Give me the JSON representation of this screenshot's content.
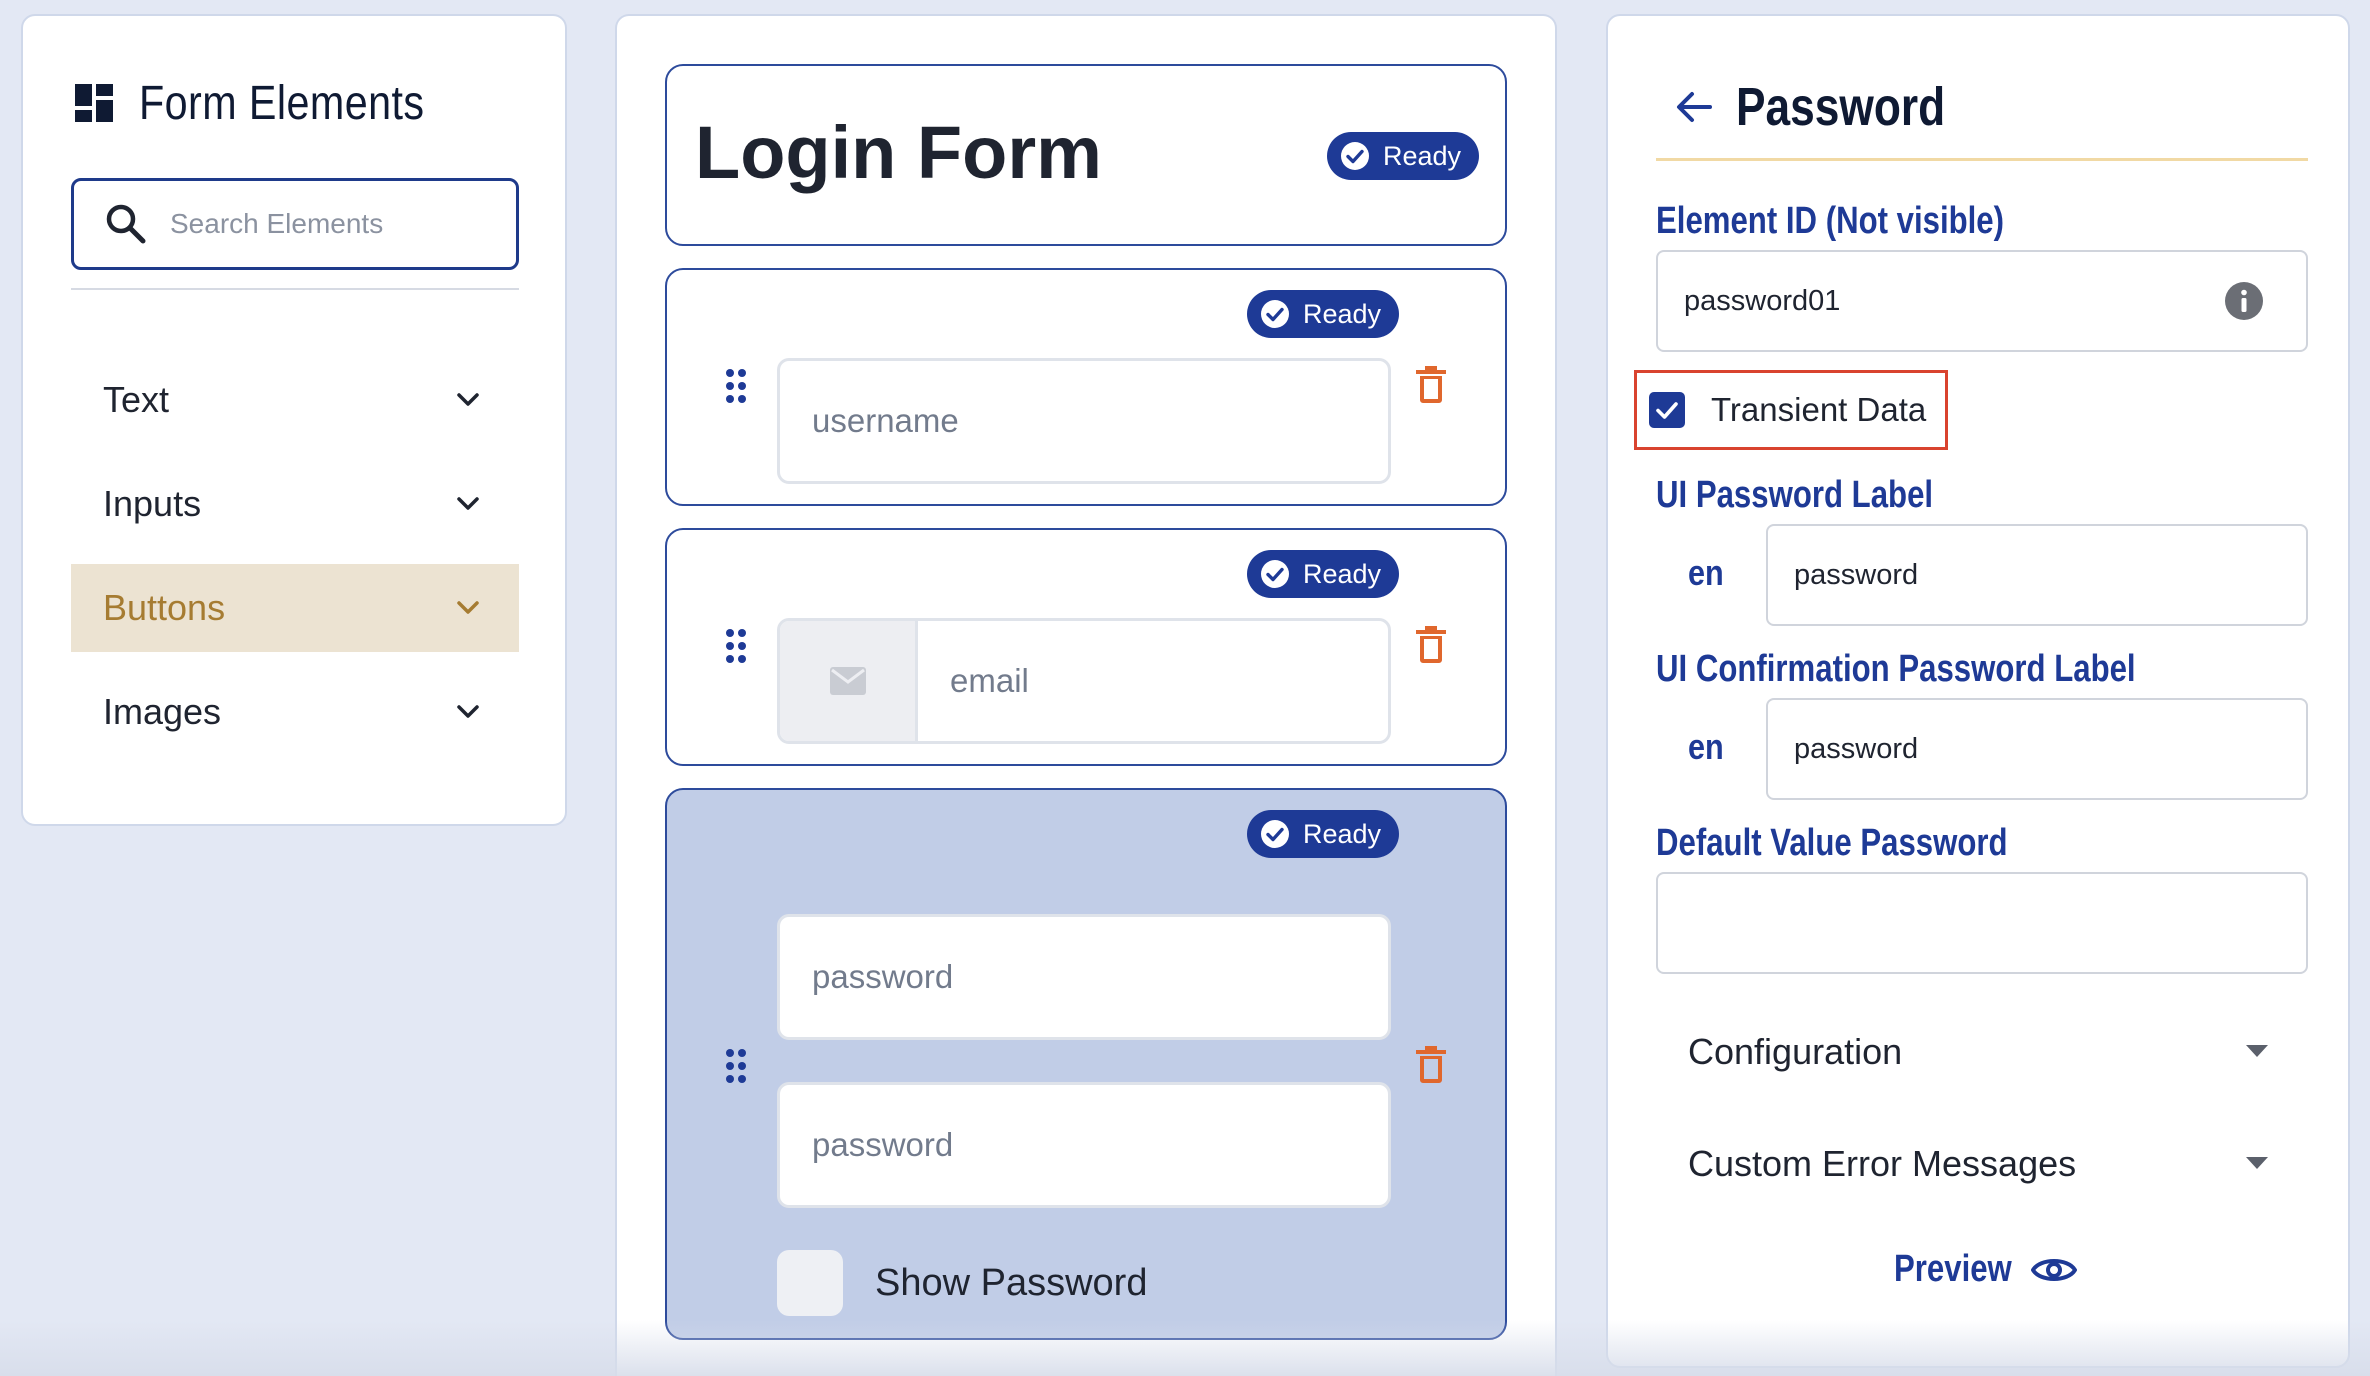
{
  "colors": {
    "page_bg": "#e3e8f4",
    "accent": "#1e3a96",
    "active_bg": "#ece3d2",
    "active_text": "#a67c32",
    "selected_card_bg": "#c1cde7",
    "danger": "#e0672d",
    "highlight_border": "#d9432f"
  },
  "left_panel": {
    "title": "Form Elements",
    "title_icon": "grid-icon",
    "search": {
      "placeholder": "Search Elements",
      "value": ""
    },
    "categories": [
      {
        "label": "Text",
        "active": false
      },
      {
        "label": "Inputs",
        "active": false
      },
      {
        "label": "Buttons",
        "active": true
      },
      {
        "label": "Images",
        "active": false
      }
    ]
  },
  "canvas": {
    "form_title": "Login Form",
    "status_label": "Ready",
    "elements": [
      {
        "type": "text-input",
        "placeholder": "username",
        "status": "Ready"
      },
      {
        "type": "email-input",
        "placeholder": "email",
        "prefix_icon": "mail-icon",
        "status": "Ready"
      },
      {
        "type": "password",
        "status": "Ready",
        "selected": true,
        "fields": [
          {
            "placeholder": "password"
          },
          {
            "placeholder": "password"
          }
        ],
        "show_password_label": "Show Password"
      }
    ]
  },
  "properties": {
    "title": "Password",
    "element_id": {
      "label": "Element ID (Not visible)",
      "value": "password01"
    },
    "transient_data": {
      "label": "Transient Data",
      "checked": true
    },
    "ui_password_label": {
      "label": "UI Password Label",
      "lang": "en",
      "value": "password"
    },
    "ui_confirmation_label": {
      "label": "UI Confirmation Password Label",
      "lang": "en",
      "value": "password"
    },
    "default_value": {
      "label": "Default Value Password",
      "value": ""
    },
    "sections": [
      {
        "label": "Configuration"
      },
      {
        "label": "Custom Error Messages"
      }
    ],
    "preview_label": "Preview"
  }
}
